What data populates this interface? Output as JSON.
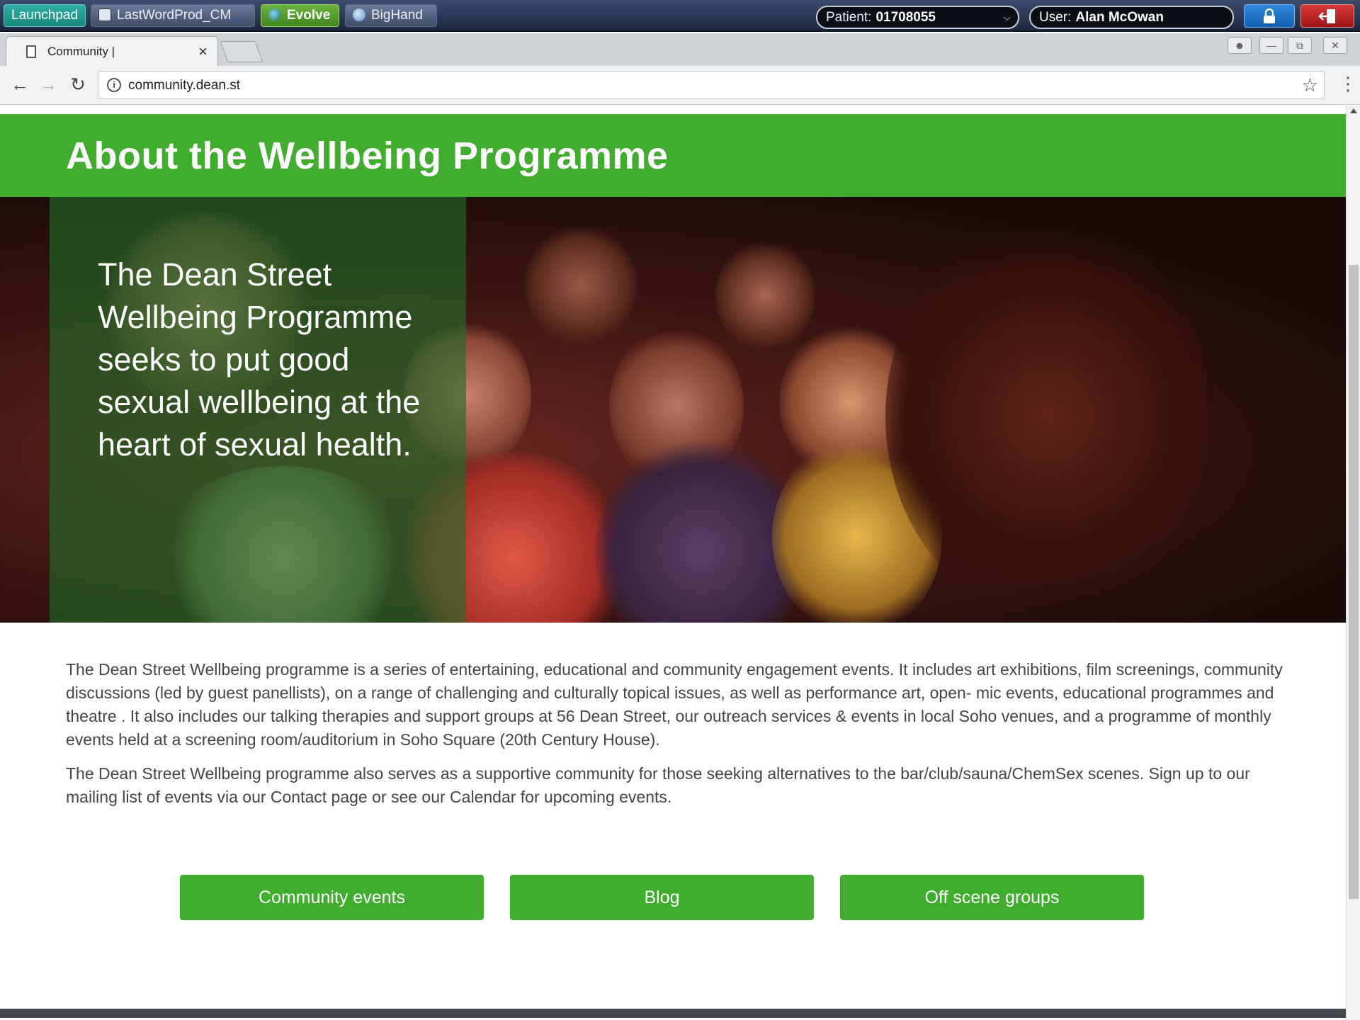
{
  "launcher": {
    "launchpad_label": "Launchpad",
    "lastword_label": "LastWordProd_CM",
    "evolve_label": "Evolve",
    "bighand_label": "BigHand",
    "patient_label": "Patient:",
    "patient_value": "01708055",
    "user_label": "User:",
    "user_value": "Alan McOwan"
  },
  "browser": {
    "tab_title": "Community |",
    "url": "community.dean.st"
  },
  "page": {
    "header_title": "About the Wellbeing Programme",
    "hero_quote": "The Dean Street Wellbeing Programme seeks to put good sexual wellbeing at the heart of sexual health.",
    "paragraphs": [
      "The Dean Street Wellbeing programme is a series of entertaining, educational and community engagement events. It includes art exhibitions, film screenings, community discussions (led by guest panellists), on a range of challenging and culturally topical issues, as well as performance art, open- mic events, educational programmes and theatre . It also includes our talking therapies and support groups at 56 Dean Street, our outreach services & events in local Soho venues, and a programme of monthly events held at a screening room/auditorium in Soho Square (20th Century House).",
      "The Dean Street Wellbeing programme also serves as a supportive community for those seeking alternatives to the bar/club/sauna/ChemSex scenes. Sign up to our mailing list of events via our Contact page or see our Calendar for upcoming events."
    ],
    "buttons": [
      "Community events",
      "Blog",
      "Off scene groups"
    ]
  },
  "colors": {
    "brand_green": "#40ad2f",
    "overlay_green": "#1e6e28"
  }
}
